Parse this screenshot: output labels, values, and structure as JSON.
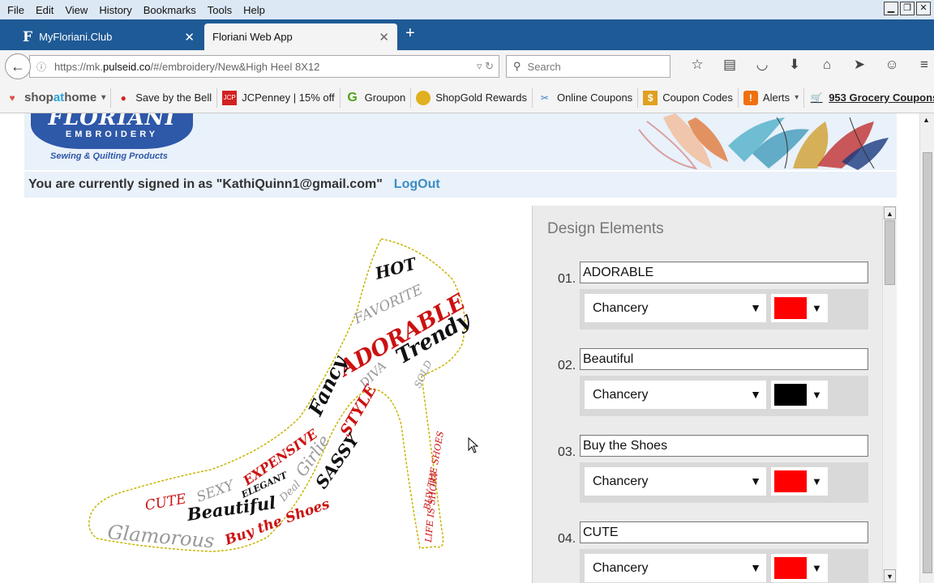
{
  "menu": [
    "File",
    "Edit",
    "View",
    "History",
    "Bookmarks",
    "Tools",
    "Help"
  ],
  "window_controls": [
    "minimize-icon",
    "restore-icon",
    "close-icon"
  ],
  "tabs": [
    {
      "label": "MyFloriani.Club",
      "favicon": "F"
    },
    {
      "label": "Floriani Web App"
    }
  ],
  "nav": {
    "url_prefix": "https://mk.",
    "url_host": "pulseid.co",
    "url_path": "/#/embroidery/New&High Heel 8X12",
    "search_placeholder": "Search"
  },
  "bookmarks": {
    "shopathome": {
      "shop": "shop",
      "at": "at",
      "home": "home"
    },
    "items": [
      {
        "label": "Save by the Bell",
        "color": "#d32020"
      },
      {
        "label": "JCPenney | 15% off",
        "color": "#d32020"
      },
      {
        "label": "Groupon",
        "color": "#53a318"
      },
      {
        "label": "ShopGold Rewards",
        "color": "#e0b020"
      },
      {
        "label": "Online Coupons",
        "color": "#3a7bd5"
      },
      {
        "label": "Coupon Codes",
        "color": "#e0a020"
      },
      {
        "label": "Alerts",
        "color": "#f07010"
      },
      {
        "label": "953 Grocery Coupons",
        "color": "#3a7bd5"
      }
    ]
  },
  "header": {
    "brand": "FLORIANI",
    "brand_sub": "EMBROIDERY",
    "tagline": "Sewing & Quilting Products"
  },
  "signin": {
    "text": "You are currently signed in as \"KathiQuinn1@gmail.com\"",
    "logout": "LogOut"
  },
  "shoe_words": [
    {
      "text": "HOT",
      "color": "#111111"
    },
    {
      "text": "FAVORITE",
      "color": "#999999"
    },
    {
      "text": "ADORABLE",
      "color": "#cc1111"
    },
    {
      "text": "Trendy",
      "color": "#111111"
    },
    {
      "text": "DIVA",
      "color": "#999999"
    },
    {
      "text": "SOLD",
      "color": "#999999"
    },
    {
      "text": "Fancy",
      "color": "#111111"
    },
    {
      "text": "STYLE",
      "color": "#cc1111"
    },
    {
      "text": "BUY THE SHOES",
      "color": "#cc1111"
    },
    {
      "text": "LIFE IS SHORT",
      "color": "#cc1111"
    },
    {
      "text": "EXPENSIVE",
      "color": "#cc1111"
    },
    {
      "text": "Girlie",
      "color": "#999999"
    },
    {
      "text": "ELEGANT",
      "color": "#111111"
    },
    {
      "text": "SEXY",
      "color": "#999999"
    },
    {
      "text": "SASSY",
      "color": "#111111"
    },
    {
      "text": "Deal",
      "color": "#999999"
    },
    {
      "text": "CUTE",
      "color": "#cc1111"
    },
    {
      "text": "Beautiful",
      "color": "#111111"
    },
    {
      "text": "Glamorous",
      "color": "#999999"
    },
    {
      "text": "Buy the Shoes",
      "color": "#cc1111"
    }
  ],
  "panel": {
    "title": "Design Elements",
    "elements": [
      {
        "num": "01.",
        "text": "ADORABLE",
        "font": "Chancery",
        "color": "#ff0000"
      },
      {
        "num": "02.",
        "text": "Beautiful",
        "font": "Chancery",
        "color": "#000000"
      },
      {
        "num": "03.",
        "text": "Buy the Shoes",
        "font": "Chancery",
        "color": "#ff0000"
      },
      {
        "num": "04.",
        "text": "CUTE",
        "font": "Chancery",
        "color": "#ff0000"
      }
    ]
  }
}
